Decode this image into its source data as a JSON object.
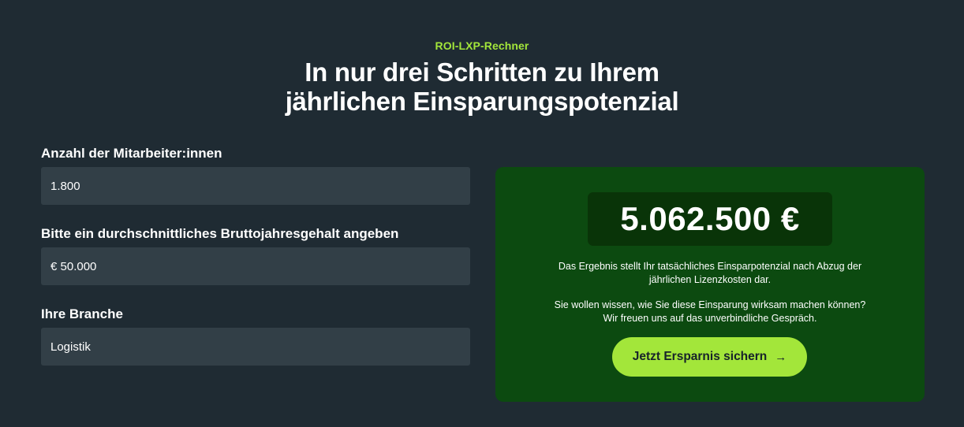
{
  "header": {
    "eyebrow": "ROI-LXP-Rechner",
    "title_line1": "In nur drei Schritten zu Ihrem",
    "title_line2": "jährlichen Einsparungspotenzial"
  },
  "form": {
    "employees": {
      "label": "Anzahl der Mitarbeiter:innen",
      "value": "1.800"
    },
    "salary": {
      "label": "Bitte ein durchschnittliches Bruttojahresgehalt angeben",
      "value": "€ 50.000"
    },
    "industry": {
      "label": "Ihre Branche",
      "value": "Logistik"
    }
  },
  "result": {
    "amount": "5.062.500 €",
    "note_line1": "Das Ergebnis stellt Ihr tatsächliches Einsparpotenzial nach Abzug der",
    "note_line2": "jährlichen Lizenzkosten dar.",
    "question_line1": "Sie wollen wissen, wie Sie diese Einsparung wirksam machen können?",
    "question_line2": "Wir freuen uns auf das unverbindliche Gespräch.",
    "cta_label": "Jetzt Ersparnis sichern",
    "cta_icon": "arrow-right-icon"
  },
  "colors": {
    "background": "#1f2b33",
    "accent": "#a3e63a",
    "input_bg": "#323f47",
    "card_bg": "#0c4a10",
    "amount_bg": "#093408"
  }
}
